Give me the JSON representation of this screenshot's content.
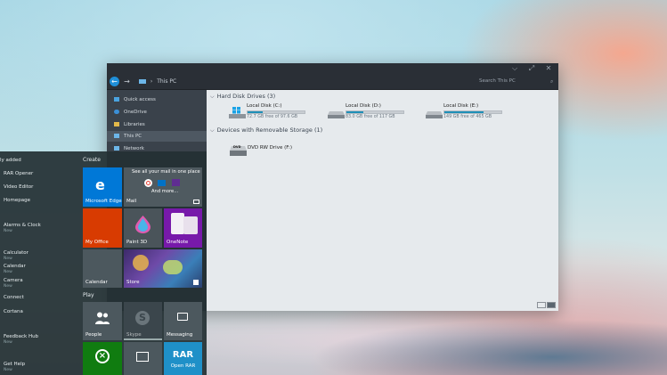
{
  "explorer": {
    "title": "This PC",
    "search_placeholder": "Search This PC",
    "sidebar": [
      {
        "label": "Quick access"
      },
      {
        "label": "OneDrive"
      },
      {
        "label": "Libraries"
      },
      {
        "label": "This PC"
      },
      {
        "label": "Network"
      }
    ],
    "groups": {
      "hard_disks": "Hard Disk Drives (3)",
      "removable": "Devices with Removable Storage (1)"
    },
    "drives": [
      {
        "name": "Local Disk (C:)",
        "size": "72.7 GB free of 97.6 GB",
        "used_fraction": 0.26
      },
      {
        "name": "Local Disk (D:)",
        "size": "83.0 GB free of 117 GB",
        "used_fraction": 0.29
      },
      {
        "name": "Local Disk (E:)",
        "size": "149 GB free of 465 GB",
        "used_fraction": 0.68
      }
    ],
    "dvd": {
      "name": "DVD RW Drive (F:)",
      "badge": "DVD"
    }
  },
  "start": {
    "list_header": "ly added",
    "apps": [
      {
        "label": "RAR Opener",
        "sub": ""
      },
      {
        "label": "Video Editor",
        "sub": ""
      },
      {
        "label": "Homepage",
        "sub": ""
      },
      {
        "label": "Alarms & Clock",
        "sub": "New"
      },
      {
        "label": "Calculator",
        "sub": "New"
      },
      {
        "label": "Calendar",
        "sub": "New"
      },
      {
        "label": "Camera",
        "sub": "New"
      },
      {
        "label": "Connect",
        "sub": ""
      },
      {
        "label": "Cortana",
        "sub": ""
      },
      {
        "label": "Feedback Hub",
        "sub": "New"
      },
      {
        "label": "Get Help",
        "sub": "New"
      }
    ],
    "create_label": "Create",
    "play_label": "Play",
    "tiles": {
      "edge": "Microsoft Edge",
      "mail_title": "See all your mail in one place",
      "mail_more": "And more...",
      "mail": "Mail",
      "office": "My Office",
      "paint3d": "Paint 3D",
      "onenote": "OneNote",
      "calendar": "Calendar",
      "store": "Store",
      "people": "People",
      "skype": "Skype",
      "messaging": "Messaging",
      "rar": "RAR",
      "rar_label": "Open RAR"
    }
  },
  "colors": {
    "accent": "#0078d7",
    "drive_fill": "#1f90b8",
    "office": "#d83b01",
    "onenote": "#7719aa",
    "xbox": "#107c10"
  }
}
